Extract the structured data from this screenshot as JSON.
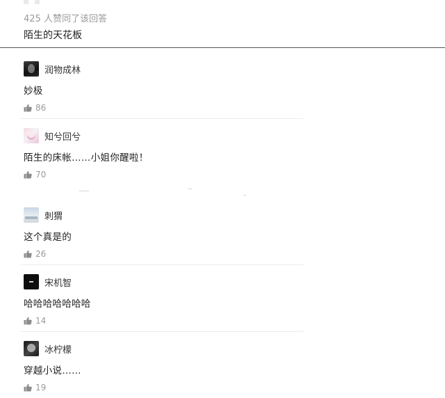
{
  "answer": {
    "likes_summary": "425 人赞同了该回答",
    "text": "陌生的天花板"
  },
  "comments": [
    {
      "username": "润物成林",
      "text": "妙极",
      "likes": "86",
      "avatar": "dark-portrait-avatar"
    },
    {
      "username": "知兮回兮",
      "text": "陌生的床帐……小姐你醒啦！",
      "likes": "70",
      "avatar": "anime-girl-avatar"
    },
    {
      "username": "刺猬",
      "text": "这个真是的",
      "likes": "26",
      "avatar": "landscape-avatar"
    },
    {
      "username": "宋机智",
      "text": "哈哈哈哈哈哈哈",
      "likes": "14",
      "avatar": "black-avatar"
    },
    {
      "username": "冰柠檬",
      "text": "穿越小说……",
      "likes": "19",
      "avatar": "bw-portrait-avatar"
    }
  ],
  "icons": {
    "like": "thumbs-up-icon"
  },
  "colors": {
    "meta_text": "#9a9a9a",
    "like_icon": "#8c8c8c",
    "divider": "#555555"
  }
}
